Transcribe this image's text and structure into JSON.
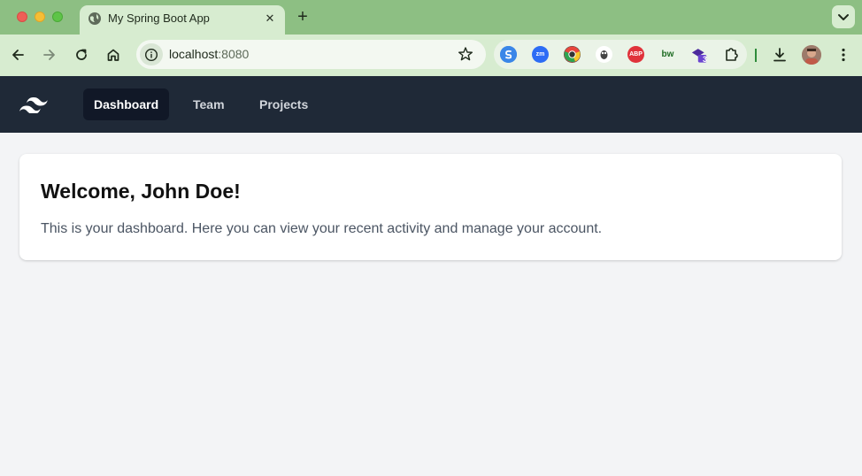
{
  "browser": {
    "tab_title": "My Spring Boot App",
    "close_glyph": "✕",
    "new_tab_glyph": "+",
    "url_host": "localhost",
    "url_port": ":8080",
    "extensions": [
      {
        "icon": "sync-extension-icon",
        "color": "#3a86e8",
        "label": "S"
      },
      {
        "icon": "zoom-extension-icon",
        "color": "#2d6cf5",
        "label": "zm"
      },
      {
        "icon": "chrome-extension-icon",
        "color": "#444444",
        "label": "●"
      },
      {
        "icon": "bug-extension-icon",
        "color": "#ffffff",
        "label": "🐞"
      },
      {
        "icon": "adblock-extension-icon",
        "color": "#e0323b",
        "label": "ABP"
      },
      {
        "icon": "bw-extension-icon",
        "color": "#eaf3e7",
        "label": "bw"
      },
      {
        "icon": "graduation-extension-icon",
        "color": "#4b2a9c",
        "label": "3"
      },
      {
        "icon": "puzzle-extensions-icon",
        "color": "#eaf3e7",
        "label": ""
      }
    ]
  },
  "app": {
    "nav": {
      "items": [
        {
          "label": "Dashboard",
          "active": true
        },
        {
          "label": "Team",
          "active": false
        },
        {
          "label": "Projects",
          "active": false
        }
      ]
    },
    "welcome": {
      "title": "Welcome, John Doe!",
      "text": "This is your dashboard. Here you can view your recent activity and manage your account."
    }
  },
  "colors": {
    "tabstrip": "#8dbf83",
    "toolbar": "#d7ecd0",
    "nav_bg": "#1f2937",
    "nav_active_bg": "#111827",
    "page_bg": "#f3f4f6"
  }
}
